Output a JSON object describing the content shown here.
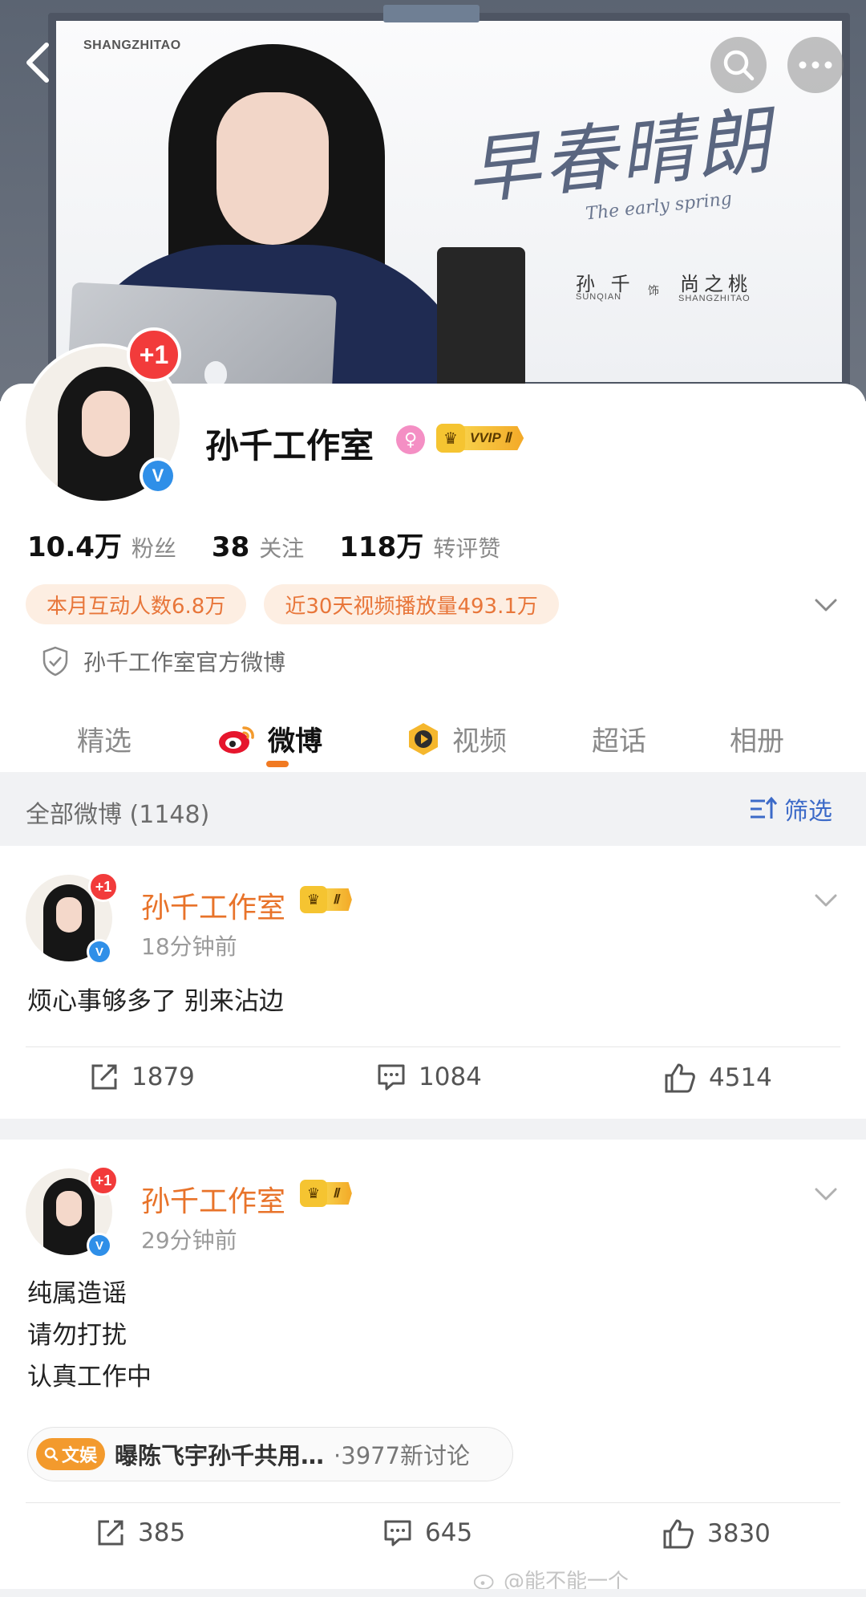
{
  "banner": {
    "board_tag": "SHANGZHITAO",
    "poster_title": "早春晴朗",
    "poster_subtitle": "The early spring",
    "actor_name": "孙 千",
    "actor_pinyin": "SUNQIAN",
    "role_marker": "饰",
    "role_name": "尚之桃",
    "role_pinyin": "SHANGZHITAO"
  },
  "profile": {
    "name": "孙千工作室",
    "avatar_badge": "+1",
    "verified_mark": "V",
    "vip_label": "VVIP Ⅱ",
    "stats": [
      {
        "value": "10.4万",
        "label": "粉丝"
      },
      {
        "value": "38",
        "label": "关注"
      },
      {
        "value": "118万",
        "label": "转评赞"
      }
    ],
    "chips": [
      "本月互动人数6.8万",
      "近30天视频播放量493.1万"
    ],
    "official_text": "孙千工作室官方微博"
  },
  "tabs": [
    {
      "label": "精选",
      "icon": "none"
    },
    {
      "label": "微博",
      "icon": "weibo-logo-icon"
    },
    {
      "label": "视频",
      "icon": "video-play-icon"
    },
    {
      "label": "超话",
      "icon": "none"
    },
    {
      "label": "相册",
      "icon": "none"
    }
  ],
  "filter": {
    "count_text": "全部微博 (1148)",
    "filter_label": "筛选"
  },
  "posts": [
    {
      "author": "孙千工作室",
      "avatar_badge": "+1",
      "verified_mark": "V",
      "level_label": "Ⅱ",
      "time": "18分钟前",
      "lines": [
        "烦心事够多了 别来沾边"
      ],
      "reposts": "1879",
      "comments": "1084",
      "likes": "4514"
    },
    {
      "author": "孙千工作室",
      "avatar_badge": "+1",
      "verified_mark": "V",
      "level_label": "Ⅱ",
      "time": "29分钟前",
      "lines": [
        "纯属造谣",
        "请勿打扰",
        "认真工作中"
      ],
      "topic_tag": "文娱",
      "topic_title": "曝陈飞宇孙千共用…",
      "topic_count": "·3977新讨论",
      "reposts": "385",
      "comments": "645",
      "likes": "3830"
    }
  ],
  "watermark": "@能不能一个"
}
